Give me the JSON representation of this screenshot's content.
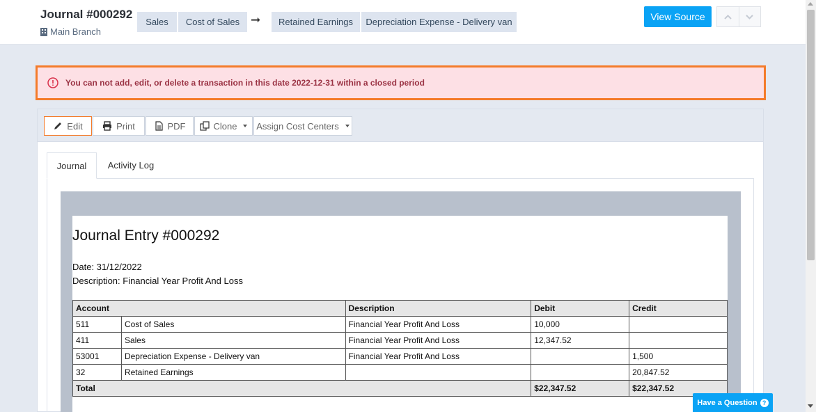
{
  "header": {
    "title": "Journal #000292",
    "branch": "Main Branch",
    "from_accounts": [
      "Sales",
      "Cost of Sales"
    ],
    "arrow": "➞",
    "to_accounts": [
      "Retained Earnings",
      "Depreciation Expense - Delivery van"
    ],
    "view_source_label": "View Source"
  },
  "alert": {
    "message": "You can not add, edit, or delete a transaction in this date 2022-12-31 within a closed period",
    "color": "#f47b2a"
  },
  "toolbar": {
    "edit": "Edit",
    "print": "Print",
    "pdf": "PDF",
    "clone": "Clone",
    "assign": "Assign Cost Centers"
  },
  "tabs": [
    "Journal",
    "Activity Log"
  ],
  "entry": {
    "title": "Journal Entry #000292",
    "date": "Date: 31/12/2022",
    "description": "Description: Financial Year Profit And Loss"
  },
  "table": {
    "headers": [
      "Account",
      "Description",
      "Debit",
      "Credit"
    ],
    "rows": [
      {
        "code": "511",
        "name": "Cost of Sales",
        "desc": "Financial Year Profit And Loss",
        "debit": "10,000",
        "credit": ""
      },
      {
        "code": "411",
        "name": "Sales",
        "desc": "Financial Year Profit And Loss",
        "debit": "12,347.52",
        "credit": ""
      },
      {
        "code": "53001",
        "name": "Depreciation Expense - Delivery van",
        "desc": "Financial Year Profit And Loss",
        "debit": "",
        "credit": "1,500"
      },
      {
        "code": "32",
        "name": "Retained Earnings",
        "desc": "",
        "debit": "",
        "credit": "20,847.52"
      }
    ],
    "total": {
      "label": "Total",
      "debit": "$22,347.52",
      "credit": "$22,347.52"
    }
  },
  "help_label": "Have a Question",
  "colors": {
    "primary": "#0aa3f5",
    "alert_bg": "#fde0e5",
    "alert_text": "#9b3344"
  }
}
